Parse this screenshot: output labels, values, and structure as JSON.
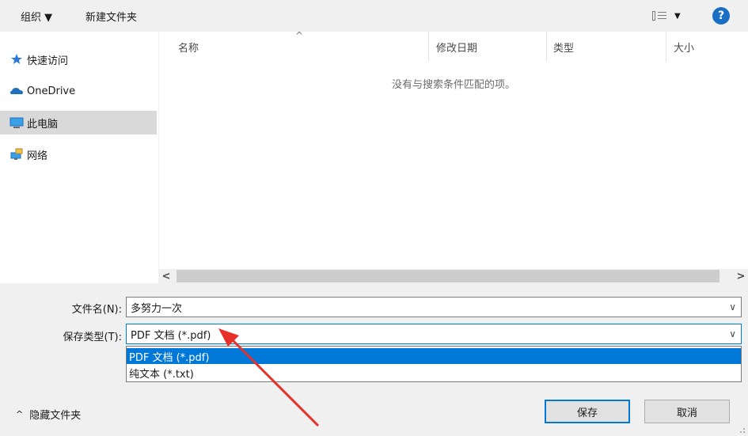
{
  "toolbar": {
    "organize_label": "组织 ▼",
    "new_folder_label": "新建文件夹",
    "view_icon": "view-options-icon",
    "view_caret": "▼",
    "help_label": "?"
  },
  "nav": {
    "items": [
      {
        "label": "快速访问",
        "icon": "star-pin-icon"
      },
      {
        "label": "OneDrive",
        "icon": "cloud-icon"
      },
      {
        "label": "此电脑",
        "icon": "computer-icon"
      },
      {
        "label": "网络",
        "icon": "network-icon"
      }
    ],
    "selected_index": 2
  },
  "list": {
    "columns": [
      "名称",
      "修改日期",
      "类型",
      "大小"
    ],
    "sort_indicator": "^",
    "empty_message": "没有与搜索条件匹配的项。"
  },
  "scrollbar": {
    "left": "<",
    "right": ">"
  },
  "form": {
    "filename_label": "文件名(N):",
    "filename_value": "多努力一次",
    "savetype_label": "保存类型(T):",
    "savetype_value": "PDF 文档 (*.pdf)",
    "savetype_options": [
      "PDF 文档 (*.pdf)",
      "纯文本 (*.txt)"
    ],
    "chevron": "∨"
  },
  "footer": {
    "hide_folders_label": "隐藏文件夹",
    "hide_folders_chevron": "^",
    "save_label": "保存",
    "cancel_label": "取消"
  },
  "colors": {
    "accent": "#0078d7",
    "selection": "#d9d9d9",
    "annotation_arrow": "#e8302a"
  }
}
